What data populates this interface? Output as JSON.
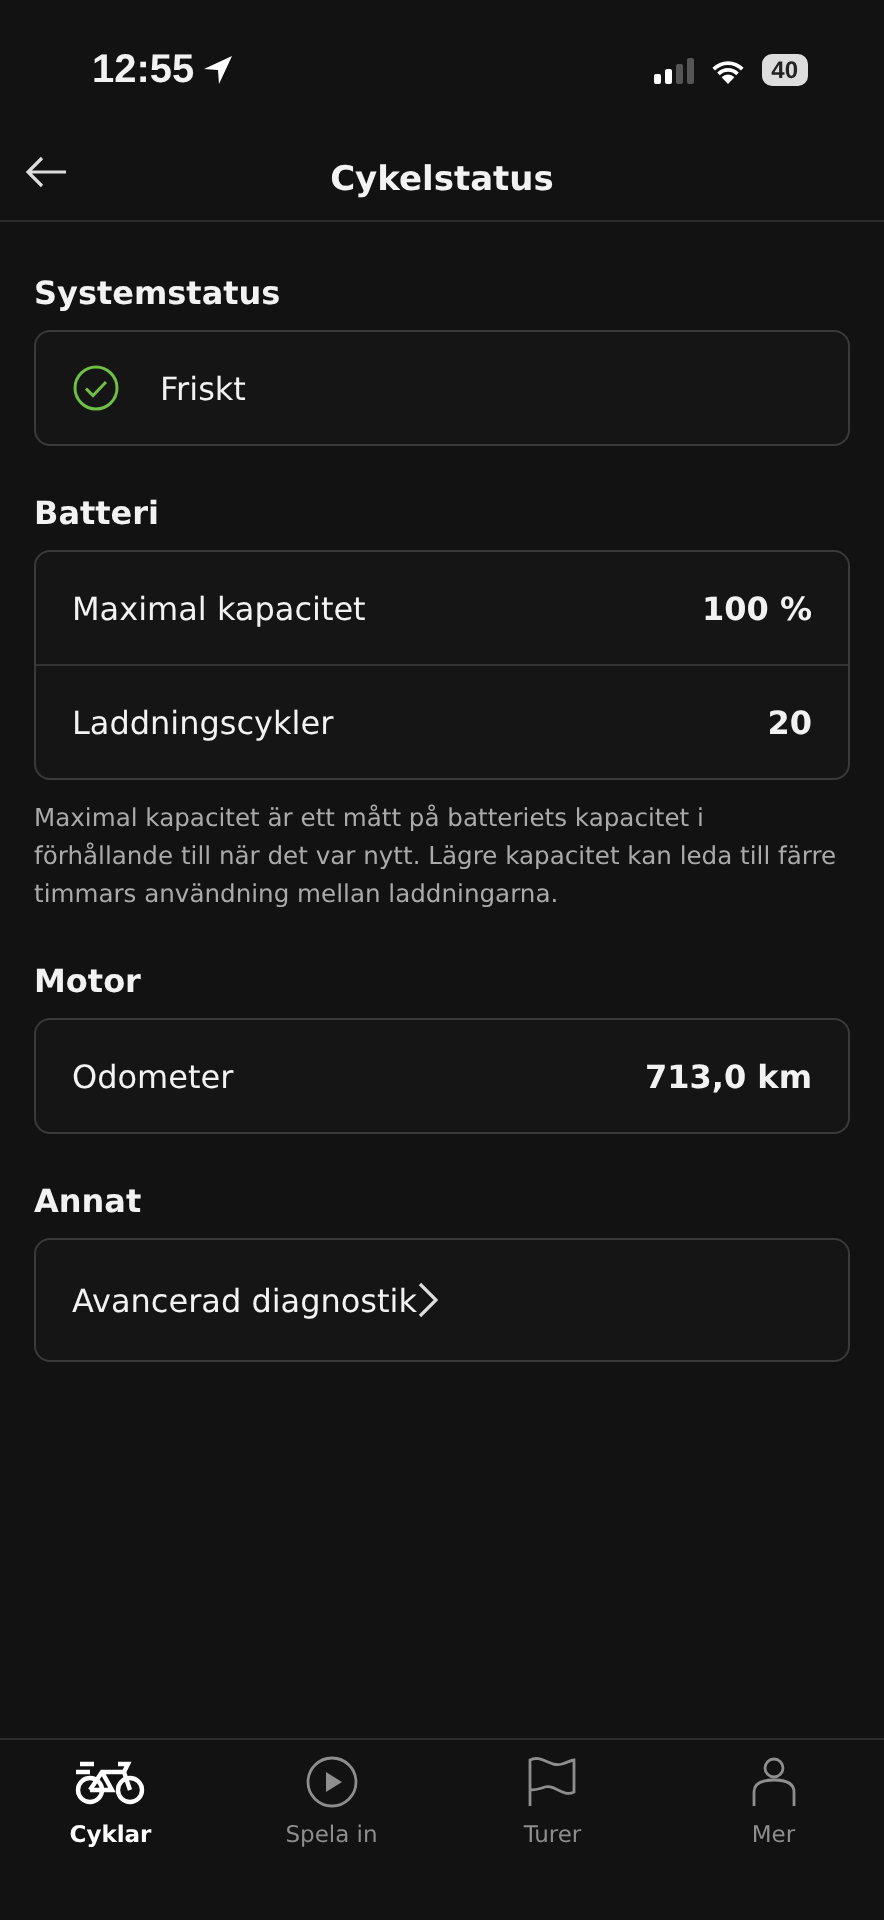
{
  "status_bar": {
    "time": "12:55",
    "battery": "40"
  },
  "header": {
    "title": "Cykelstatus"
  },
  "sections": [
    {
      "title": "Systemstatus",
      "rows": [
        {
          "kind": "status",
          "label": "Friskt"
        }
      ]
    },
    {
      "title": "Batteri",
      "rows": [
        {
          "kind": "value",
          "label": "Maximal kapacitet",
          "value": "100 %"
        },
        {
          "kind": "value",
          "label": "Laddningscykler",
          "value": "20"
        }
      ],
      "note": "Maximal kapacitet är ett mått på batteriets kapacitet i förhållande till när det var nytt. Lägre kapacitet kan leda till färre timmars användning mellan laddningarna."
    },
    {
      "title": "Motor",
      "rows": [
        {
          "kind": "value",
          "label": "Odometer",
          "value": "713,0 km"
        }
      ]
    },
    {
      "title": "Annat",
      "rows": [
        {
          "kind": "link",
          "label": "Avancerad diagnostik"
        }
      ]
    }
  ],
  "tabs": [
    {
      "label": "Cyklar",
      "selected": true
    },
    {
      "label": "Spela in",
      "selected": false
    },
    {
      "label": "Turer",
      "selected": false
    },
    {
      "label": "Mer",
      "selected": false
    }
  ]
}
